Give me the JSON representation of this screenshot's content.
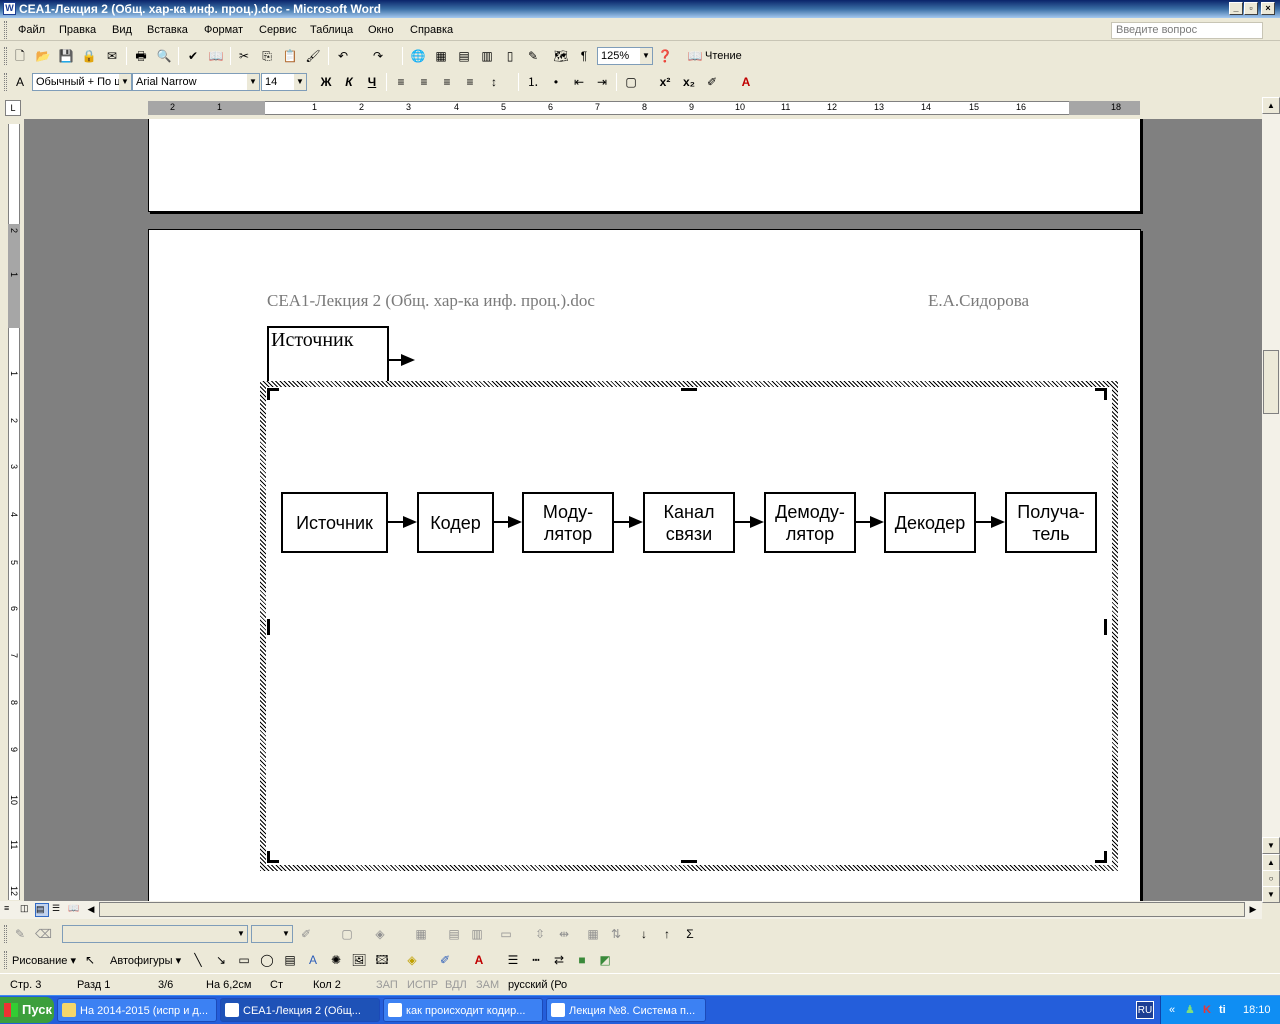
{
  "window": {
    "title": "СЕА1-Лекция 2 (Общ. хар-ка инф. проц.).doc - Microsoft Word"
  },
  "menu": {
    "items": [
      "Файл",
      "Правка",
      "Вид",
      "Вставка",
      "Формат",
      "Сервис",
      "Таблица",
      "Окно",
      "Справка"
    ],
    "help_placeholder": "Введите вопрос"
  },
  "toolbar_standard": {
    "zoom": "125%",
    "reading_label": "Чтение"
  },
  "toolbar_format": {
    "style": "Обычный + По ц",
    "font": "Arial Narrow",
    "size": "14",
    "bold": "Ж",
    "italic": "К",
    "underline": "Ч"
  },
  "ruler": {
    "h_numbers": [
      "2",
      "1",
      "1",
      "2",
      "3",
      "4",
      "5",
      "6",
      "7",
      "8",
      "9",
      "10",
      "11",
      "12",
      "13",
      "14",
      "15",
      "16",
      "18"
    ],
    "v_numbers": [
      "2",
      "1",
      "1",
      "2",
      "3",
      "4",
      "5",
      "6",
      "7",
      "8",
      "9",
      "10",
      "11",
      "12"
    ]
  },
  "document": {
    "header_left": "СЕА1-Лекция 2 (Общ. хар-ка инф. проц.).doc",
    "header_right": "Е.А.Сидорова",
    "stray_box_label": "Источник",
    "diagram_blocks": [
      "Источник",
      "Кодер",
      "Моду-\nлятор",
      "Канал\nсвязи",
      "Демоду-\nлятор",
      "Декодер",
      "Получа-\nтель"
    ]
  },
  "drawing_toolbar": {
    "draw_label": "Рисование ▾",
    "autoshapes_label": "Автофигуры ▾"
  },
  "status": {
    "page": "Стр. 3",
    "section": "Разд 1",
    "pages": "3/6",
    "at": "На 6,2см",
    "line": "Ст",
    "col": "Кол 2",
    "rec": "ЗАП",
    "trk": "ИСПР",
    "ext": "ВДЛ",
    "ovr": "ЗАМ",
    "lang": "русский (Ро"
  },
  "taskbar": {
    "start": "Пуск",
    "tasks": [
      "На 2014-2015 (испр и д...",
      "СЕА1-Лекция 2 (Общ...",
      "как происходит кодир...",
      "Лекция №8. Система п..."
    ],
    "lang": "RU",
    "clock": "18:10"
  },
  "colors": {
    "titlebar": "#0a246a",
    "taskbar": "#245edb",
    "docbg": "#808080"
  }
}
